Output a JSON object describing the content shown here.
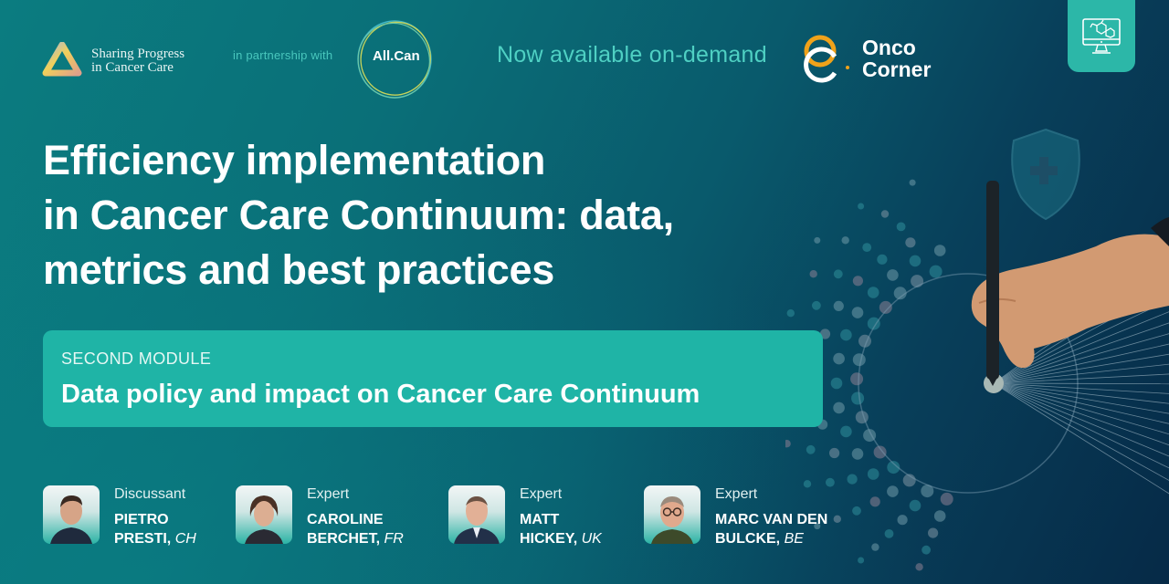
{
  "header": {
    "org_logo": {
      "icon": "triangle-logo-icon",
      "line1": "Sharing Progress",
      "line2": "in Cancer Care"
    },
    "partnership_text": "in partnership with",
    "partner_logo": {
      "icon": "circle-rings-logo-icon",
      "name": "All.Can"
    },
    "availability": "Now available on-demand",
    "brand_logo": {
      "icon": "oc-logo-icon",
      "line1": "Onco",
      "line2": "Corner"
    },
    "badge_icon": "monitor-molecule-icon"
  },
  "title": {
    "lines": [
      "Efficiency implementation",
      "in Cancer Care Continuum: data,",
      "metrics and best practices"
    ]
  },
  "module": {
    "label": "SECOND MODULE",
    "title": "Data policy and impact on Cancer Care Continuum"
  },
  "speakers": [
    {
      "role": "Discussant",
      "first": "PIETRO",
      "last": "PRESTI",
      "country": "CH"
    },
    {
      "role": "Expert",
      "first": "CAROLINE",
      "last": "BERCHET",
      "country": "FR"
    },
    {
      "role": "Expert",
      "first": "MATT",
      "last": "HICKEY",
      "country": "UK"
    },
    {
      "role": "Expert",
      "first": "MARC VAN DEN",
      "last": "BULCKE",
      "country": "BE"
    }
  ],
  "decor": {
    "shield_icon": "shield-cross-icon",
    "hand_icon": "hand-pen-icon"
  },
  "colors": {
    "accent_teal": "#1fb4a6",
    "accent_text": "#4fd0c3",
    "brand_orange": "#f0a21a",
    "bg_start": "#0b7c80",
    "bg_end": "#062a47"
  }
}
